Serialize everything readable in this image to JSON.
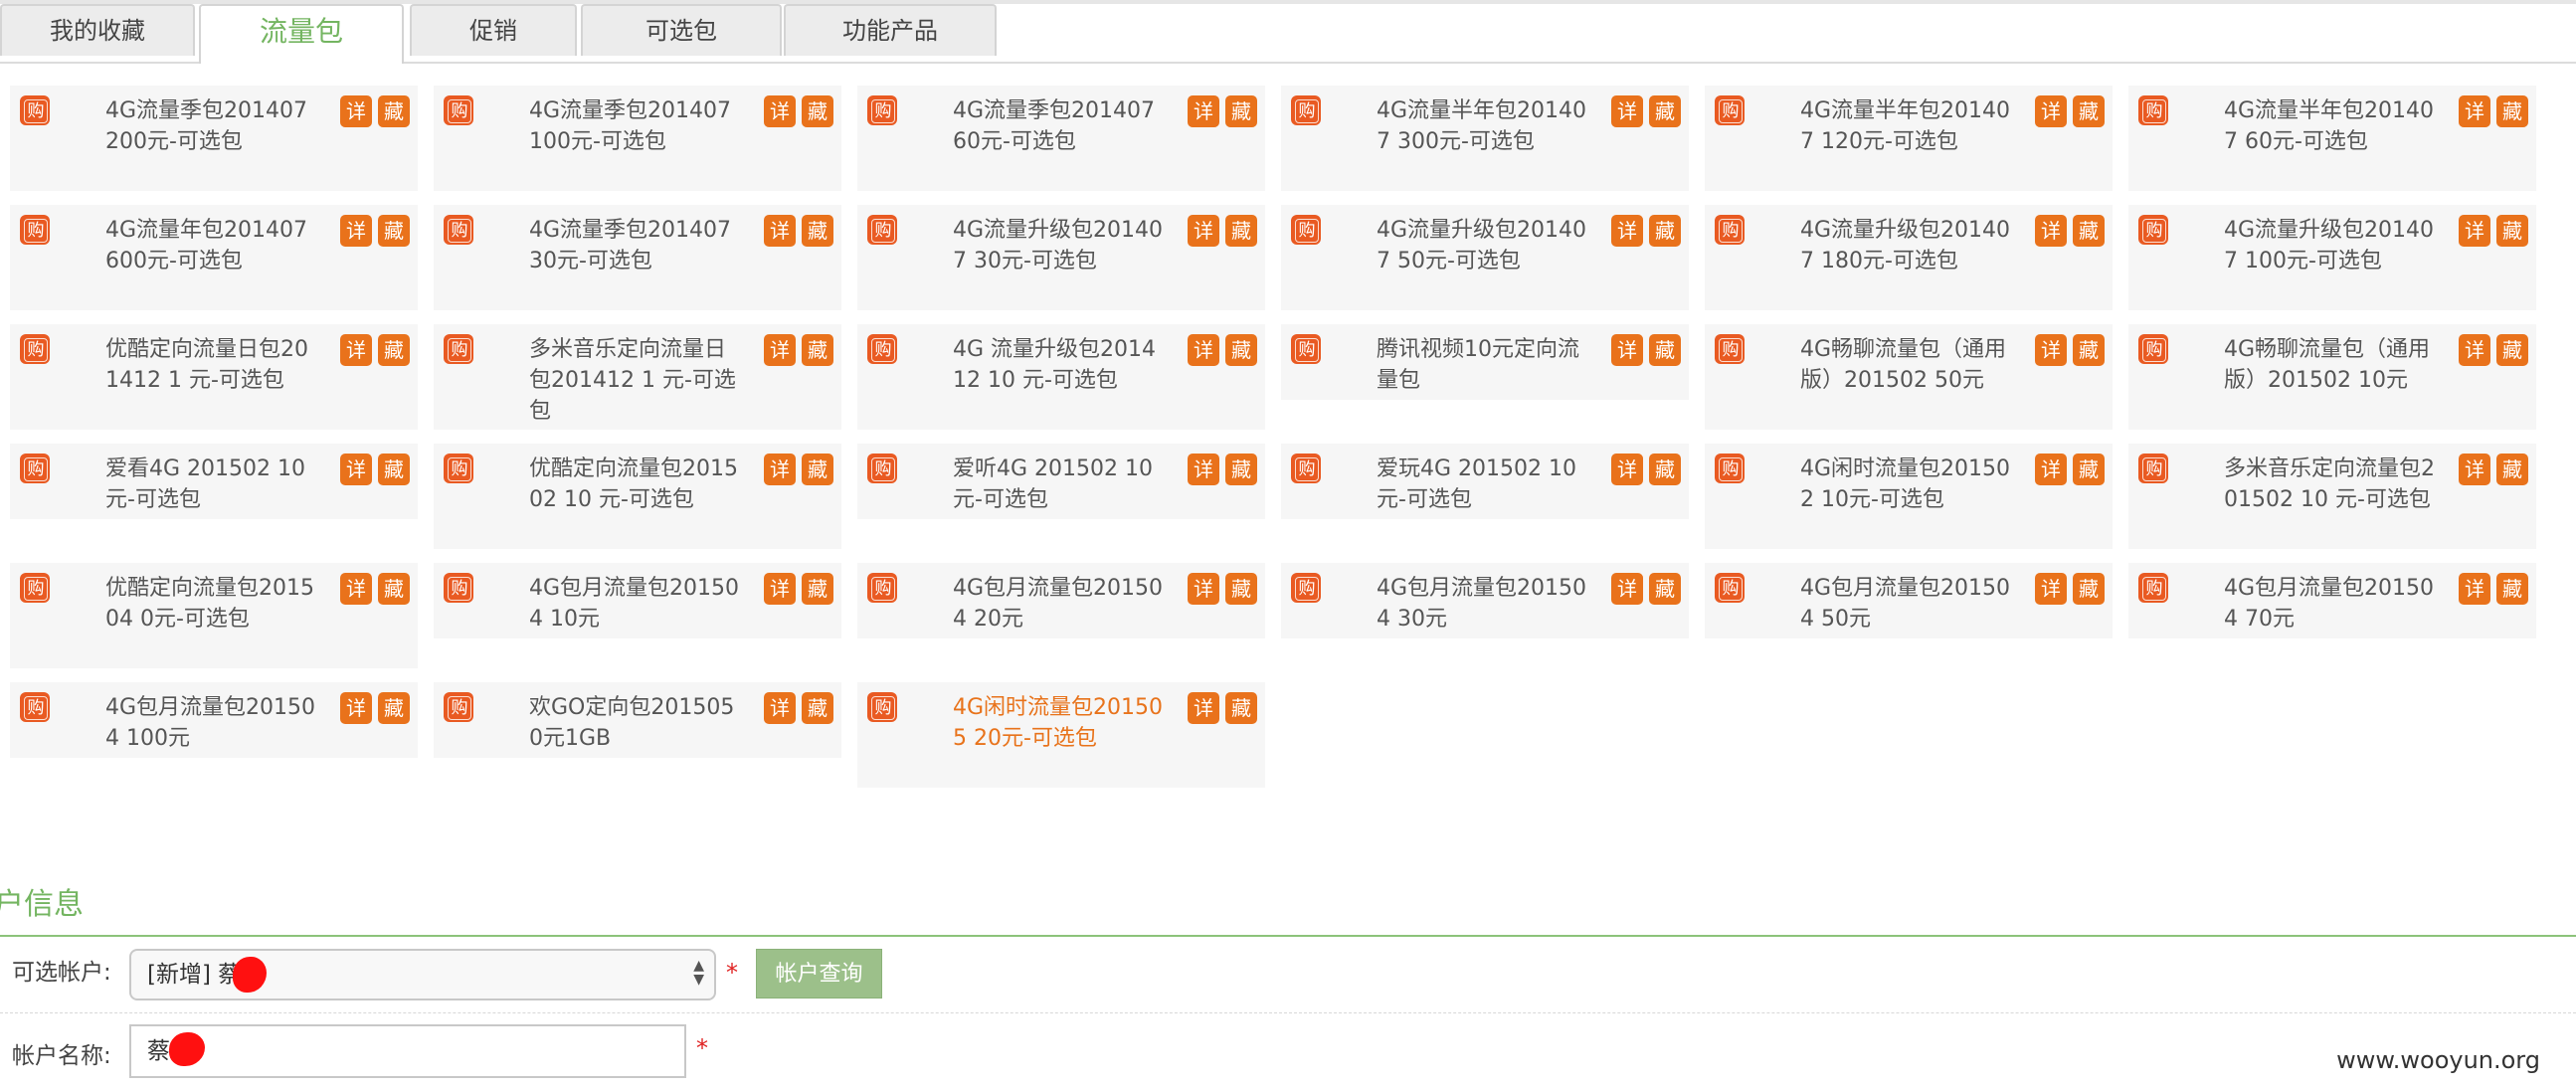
{
  "tabs": [
    "我的收藏",
    "流量包",
    "促销",
    "可选包",
    "功能产品"
  ],
  "active_tab": 1,
  "card_buttons": {
    "buy": "购",
    "detail": "详",
    "fav": "藏"
  },
  "products": [
    "4G流量季包201407 200元-可选包",
    "4G流量季包201407 100元-可选包",
    "4G流量季包201407 60元-可选包",
    "4G流量半年包201407 300元-可选包",
    "4G流量半年包201407 120元-可选包",
    "4G流量半年包201407 60元-可选包",
    "4G流量年包201407 600元-可选包",
    "4G流量季包201407 30元-可选包",
    "4G流量升级包201407 30元-可选包",
    "4G流量升级包201407 50元-可选包",
    "4G流量升级包201407 180元-可选包",
    "4G流量升级包201407 100元-可选包",
    "优酷定向流量日包201412 1 元-可选包",
    "多米音乐定向流量日包201412 1 元-可选包",
    "4G 流量升级包201412 10 元-可选包",
    "腾讯视频10元定向流量包",
    "4G畅聊流量包（通用版）201502 50元",
    "4G畅聊流量包（通用版）201502 10元",
    "爱看4G 201502 10 元-可选包",
    "优酷定向流量包201502 10 元-可选包",
    "爱听4G 201502 10 元-可选包",
    "爱玩4G 201502 10 元-可选包",
    "4G闲时流量包201502 10元-可选包",
    "多米音乐定向流量包201502 10 元-可选包",
    "优酷定向流量包201504 0元-可选包",
    "4G包月流量包201504 10元",
    "4G包月流量包201504 20元",
    "4G包月流量包201504 30元",
    "4G包月流量包201504 50元",
    "4G包月流量包201504 70元",
    "4G包月流量包201504 100元",
    "欢GO定向包201505 0元1GB",
    "4G闲时流量包201505 20元-可选包"
  ],
  "highlighted_product": 32,
  "account": {
    "section_title": "户信息",
    "select_label": "可选帐户:",
    "select_value": "[新增] 蔡",
    "query_button": "帐户查询",
    "name_label": "帐户名称:",
    "name_value": "蔡",
    "required_mark": "*"
  },
  "watermark": "www.wooyun.org",
  "colors": {
    "accent_green": "#74b561",
    "buy_orange": "#e95a22",
    "action_orange": "#e9721b",
    "highlight_text": "#e8731b"
  }
}
